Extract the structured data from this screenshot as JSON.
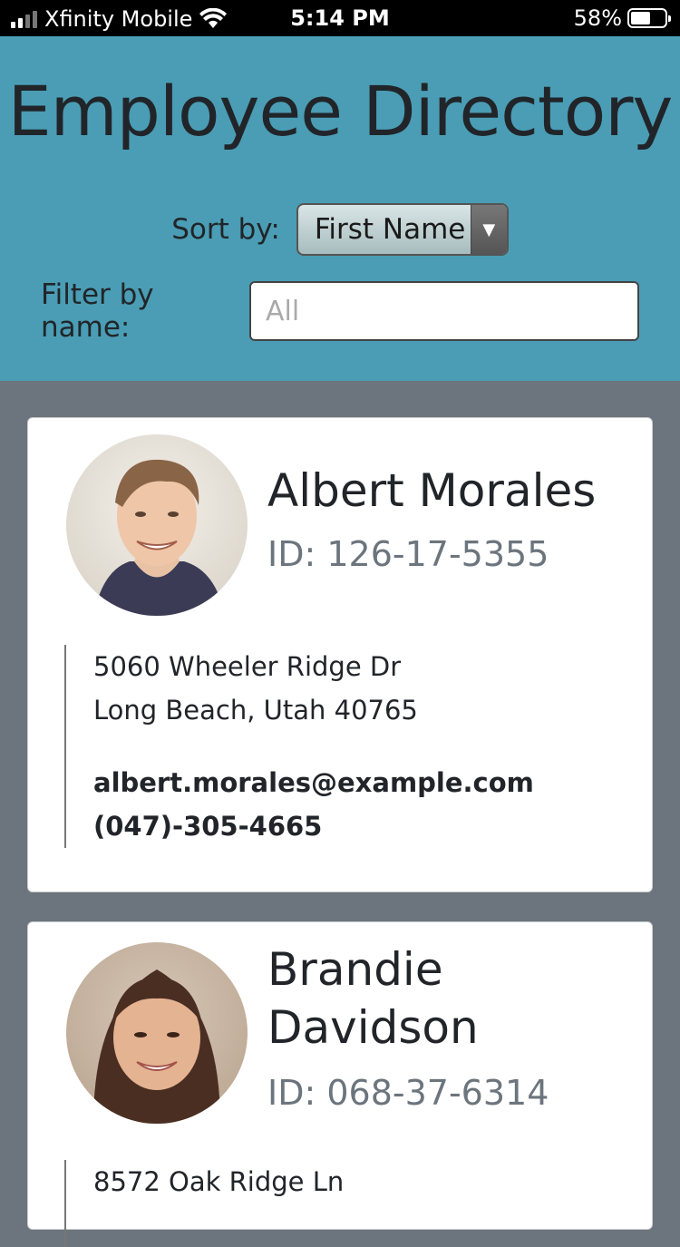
{
  "status_bar": {
    "carrier": "Xfinity Mobile",
    "time": "5:14 PM",
    "battery_percent": "58%",
    "battery_level": 0.58
  },
  "header": {
    "title": "Employee Directory",
    "sort_label": "Sort by:",
    "sort_value": "First Name",
    "filter_label": "Filter by name:",
    "filter_placeholder": "All",
    "filter_value": ""
  },
  "employees": [
    {
      "first_name": "Albert",
      "last_name": "Morales",
      "name": "Albert Morales",
      "id": "ID: 126-17-5355",
      "address_line1": "5060 Wheeler Ridge Dr",
      "address_line2": "Long Beach, Utah 40765",
      "email": "albert.morales@example.com",
      "phone": "(047)-305-4665"
    },
    {
      "first_name": "Brandie",
      "last_name": "Davidson",
      "name_line1": "Brandie",
      "name_line2": "Davidson",
      "id": "ID: 068-37-6314",
      "address_line1": "8572 Oak Ridge Ln"
    }
  ]
}
